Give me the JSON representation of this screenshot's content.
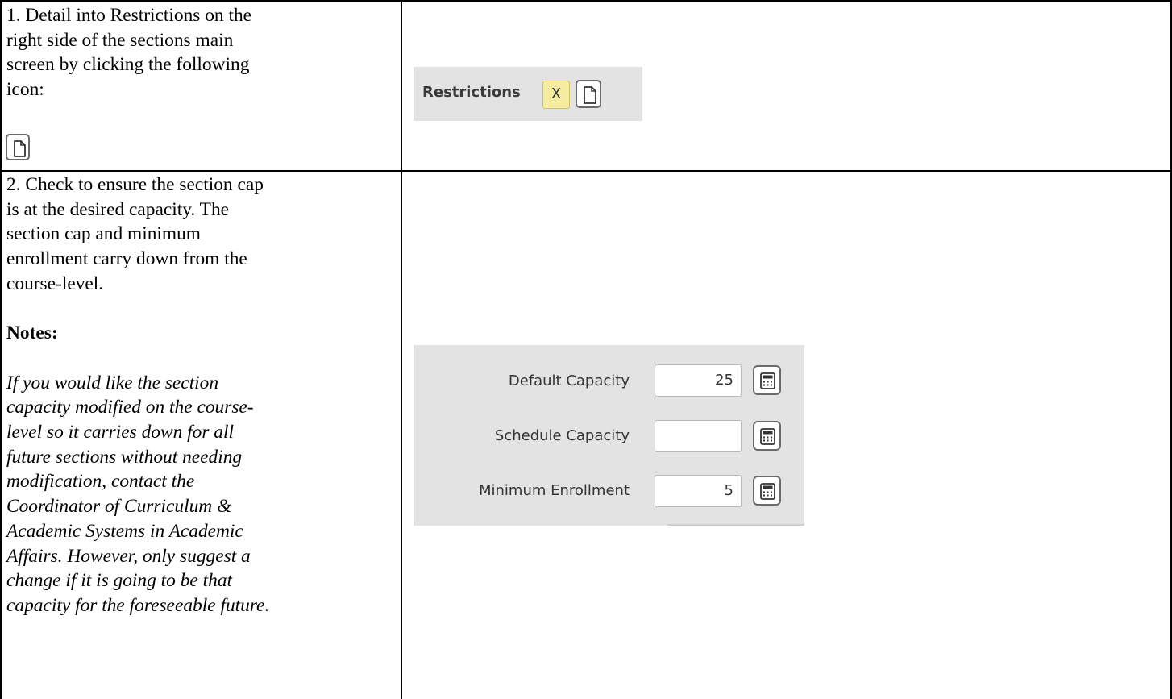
{
  "steps": [
    {
      "instruction_lines": [
        "1. Detail into Restrictions on the",
        "right side of the sections main",
        "screen by clicking the following",
        "icon:"
      ],
      "inline_icon": "page-icon"
    },
    {
      "instruction_lines": [
        "2. Check to ensure the section cap",
        "is at the desired capacity. The",
        "section cap and minimum",
        "enrollment carry down from the",
        "course-level."
      ],
      "notes_heading": "Notes:",
      "notes_lines": [
        "If you would like the section",
        "capacity modified on the course-",
        "level so it carries down for all",
        "future sections without needing",
        "modification, contact the",
        "Coordinator of Curriculum &",
        "Academic Systems in Academic",
        "Affairs. However, only suggest a",
        "change if it is going to be that",
        "capacity for the foreseeable future."
      ]
    }
  ],
  "restrictions_screenshot": {
    "label": "Restrictions",
    "value": "X",
    "button_icon": "page-icon"
  },
  "capacity_screenshot": {
    "fields": [
      {
        "label": "Default Capacity",
        "value": "25",
        "button_icon": "calculator-icon"
      },
      {
        "label": "Schedule Capacity",
        "value": "",
        "button_icon": "calculator-icon"
      },
      {
        "label": "Minimum Enrollment",
        "value": "5",
        "button_icon": "calculator-icon"
      }
    ]
  },
  "colors": {
    "panel_background": "#e3e3e3",
    "x_field_background": "#f6ec9f",
    "border": "#000000"
  }
}
